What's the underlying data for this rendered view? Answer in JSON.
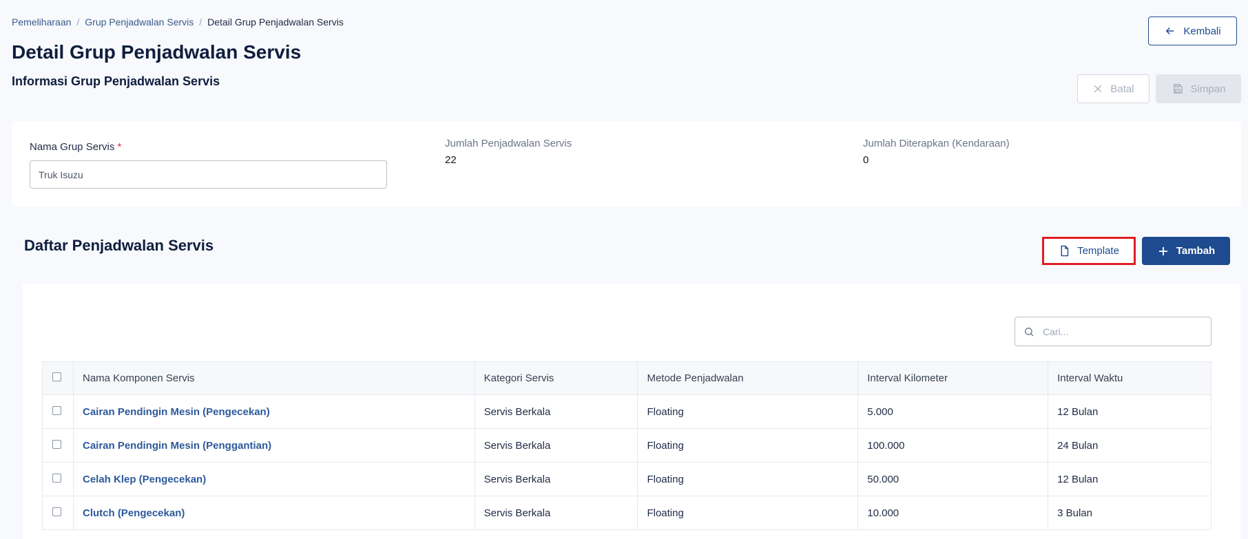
{
  "breadcrumb": [
    "Pemeliharaan",
    "Grup Penjadwalan Servis",
    "Detail Grup Penjadwalan Servis"
  ],
  "page_title": "Detail Grup Penjadwalan Servis",
  "section_title": "Informasi Grup Penjadwalan Servis",
  "buttons": {
    "back": "Kembali",
    "cancel": "Batal",
    "save": "Simpan",
    "template": "Template",
    "add": "Tambah"
  },
  "form": {
    "group_name_label": "Nama Grup Servis",
    "required_mark": "*",
    "group_name_value": "Truk Isuzu",
    "schedule_count_label": "Jumlah Penjadwalan Servis",
    "schedule_count_value": "22",
    "applied_count_label": "Jumlah Diterapkan (Kendaraan)",
    "applied_count_value": "0"
  },
  "list_title": "Daftar Penjadwalan Servis",
  "search": {
    "placeholder": "Cari..."
  },
  "table": {
    "headers": [
      "Nama Komponen Servis",
      "Kategori Servis",
      "Metode Penjadwalan",
      "Interval Kilometer",
      "Interval Waktu"
    ],
    "rows": [
      [
        "Cairan Pendingin Mesin (Pengecekan)",
        "Servis Berkala",
        "Floating",
        "5.000",
        "12 Bulan"
      ],
      [
        "Cairan Pendingin Mesin (Penggantian)",
        "Servis Berkala",
        "Floating",
        "100.000",
        "24 Bulan"
      ],
      [
        "Celah Klep (Pengecekan)",
        "Servis Berkala",
        "Floating",
        "50.000",
        "12 Bulan"
      ],
      [
        "Clutch (Pengecekan)",
        "Servis Berkala",
        "Floating",
        "10.000",
        "3 Bulan"
      ]
    ]
  },
  "colors": {
    "primary": "#1e4b8f",
    "highlight": "#e11d24",
    "link": "#2d5a9c"
  }
}
